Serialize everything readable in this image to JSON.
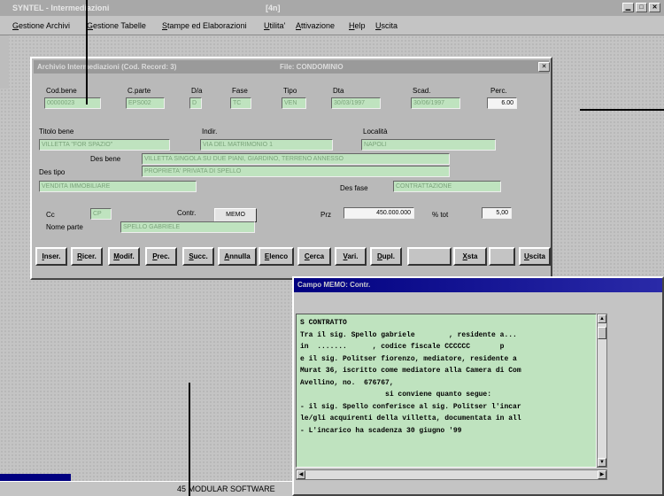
{
  "main_window": {
    "title": "SYNTEL - Intermediazioni",
    "number": "[4n]"
  },
  "menu": [
    "Gestione Archivi",
    "Gestione Tabelle",
    "Stampe ed Elaborazioni",
    "Utilita'",
    "Attivazione",
    "Help",
    "Uscita"
  ],
  "archive_window": {
    "title": "Archivio Intermediazioni (Cod. Record: 3)",
    "file_label": "File: CONDOMINIO",
    "fields": {
      "cod_bene": {
        "label": "Cod.bene",
        "value": "00000023"
      },
      "c_parte": {
        "label": "C.parte",
        "value": "EPS002"
      },
      "d_a": {
        "label": "D/a",
        "value": "D"
      },
      "fase": {
        "label": "Fase",
        "value": "TC"
      },
      "tipo": {
        "label": "Tipo",
        "value": "VEN"
      },
      "dta": {
        "label": "Dta",
        "value": "30/03/1997"
      },
      "scad": {
        "label": "Scad.",
        "value": "30/06/1997"
      },
      "perc": {
        "label": "Perc.",
        "value": "6.00"
      },
      "titolo_bene": {
        "label": "Titolo bene",
        "value": "VILLETTA \"FOR SPAZIO\""
      },
      "indir": {
        "label": "Indir.",
        "value": "VIA DEL MATRIMONIO 1"
      },
      "localita": {
        "label": "Località",
        "value": "NAPOLI"
      },
      "des_bene": {
        "label": "Des bene",
        "value": "VILLETTA SINGOLA SU DUE PIANI, GIARDINO, TERRENO ANNESSO"
      },
      "des_bene_2": {
        "value": "PROPRIETA' PRIVATA DI SPELLO"
      },
      "des_tipo": {
        "label": "Des tipo",
        "value": "VENDITA IMMOBILIARE"
      },
      "des_fase": {
        "label": "Des fase",
        "value": "CONTRATTAZIONE"
      },
      "cc": {
        "label": "Cc",
        "value": "CP"
      },
      "contr": {
        "label": "Contr."
      },
      "memo_button": "MEMO",
      "prz": {
        "label": "Prz",
        "value": "450.000.000"
      },
      "pct_tot": {
        "label": "% tot",
        "value": "5,00"
      },
      "nome_parte": {
        "label": "Nome parte",
        "value": "SPELLO GABRIELE"
      }
    },
    "buttons": [
      "Inser.",
      "Ricer.",
      "Modif.",
      "Prec.",
      "Succ.",
      "Annulla",
      "Elenco",
      "Cerca",
      "Vari.",
      "Dupl.",
      "",
      "Xsta",
      "",
      "Uscita"
    ]
  },
  "memo_window": {
    "title": "Campo MEMO: Contr.",
    "lines": [
      "S CONTRATTO",
      "",
      "Tra il sig. Spello gabriele        , residente a...",
      "in  .......      , codice fiscale CCCCCC       p",
      "e il sig. Politser fiorenzo, mediatore, residente a",
      "Murat 36, iscritto come mediatore alla Camera di Com",
      "Avellino, no.  676767,",
      "                    si conviene quanto segue:",
      "",
      "- il sig. Spello conferisce al sig. Politser l'incar",
      "le/gli acquirenti della villetta, documentata in all",
      "",
      "- L'incarico ha scadenza 30 giugno '99"
    ]
  },
  "status_bar": {
    "text": "45 MODULAR SOFTWARE"
  }
}
